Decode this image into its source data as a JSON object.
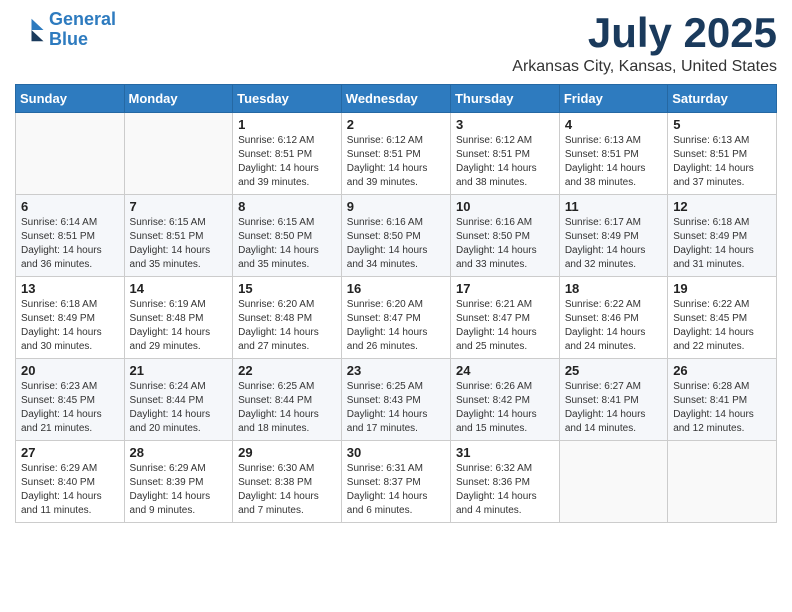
{
  "header": {
    "logo_line1": "General",
    "logo_line2": "Blue",
    "month": "July 2025",
    "location": "Arkansas City, Kansas, United States"
  },
  "days_of_week": [
    "Sunday",
    "Monday",
    "Tuesday",
    "Wednesday",
    "Thursday",
    "Friday",
    "Saturday"
  ],
  "weeks": [
    [
      {
        "day": "",
        "sunrise": "",
        "sunset": "",
        "daylight": ""
      },
      {
        "day": "",
        "sunrise": "",
        "sunset": "",
        "daylight": ""
      },
      {
        "day": "1",
        "sunrise": "Sunrise: 6:12 AM",
        "sunset": "Sunset: 8:51 PM",
        "daylight": "Daylight: 14 hours and 39 minutes."
      },
      {
        "day": "2",
        "sunrise": "Sunrise: 6:12 AM",
        "sunset": "Sunset: 8:51 PM",
        "daylight": "Daylight: 14 hours and 39 minutes."
      },
      {
        "day": "3",
        "sunrise": "Sunrise: 6:12 AM",
        "sunset": "Sunset: 8:51 PM",
        "daylight": "Daylight: 14 hours and 38 minutes."
      },
      {
        "day": "4",
        "sunrise": "Sunrise: 6:13 AM",
        "sunset": "Sunset: 8:51 PM",
        "daylight": "Daylight: 14 hours and 38 minutes."
      },
      {
        "day": "5",
        "sunrise": "Sunrise: 6:13 AM",
        "sunset": "Sunset: 8:51 PM",
        "daylight": "Daylight: 14 hours and 37 minutes."
      }
    ],
    [
      {
        "day": "6",
        "sunrise": "Sunrise: 6:14 AM",
        "sunset": "Sunset: 8:51 PM",
        "daylight": "Daylight: 14 hours and 36 minutes."
      },
      {
        "day": "7",
        "sunrise": "Sunrise: 6:15 AM",
        "sunset": "Sunset: 8:51 PM",
        "daylight": "Daylight: 14 hours and 35 minutes."
      },
      {
        "day": "8",
        "sunrise": "Sunrise: 6:15 AM",
        "sunset": "Sunset: 8:50 PM",
        "daylight": "Daylight: 14 hours and 35 minutes."
      },
      {
        "day": "9",
        "sunrise": "Sunrise: 6:16 AM",
        "sunset": "Sunset: 8:50 PM",
        "daylight": "Daylight: 14 hours and 34 minutes."
      },
      {
        "day": "10",
        "sunrise": "Sunrise: 6:16 AM",
        "sunset": "Sunset: 8:50 PM",
        "daylight": "Daylight: 14 hours and 33 minutes."
      },
      {
        "day": "11",
        "sunrise": "Sunrise: 6:17 AM",
        "sunset": "Sunset: 8:49 PM",
        "daylight": "Daylight: 14 hours and 32 minutes."
      },
      {
        "day": "12",
        "sunrise": "Sunrise: 6:18 AM",
        "sunset": "Sunset: 8:49 PM",
        "daylight": "Daylight: 14 hours and 31 minutes."
      }
    ],
    [
      {
        "day": "13",
        "sunrise": "Sunrise: 6:18 AM",
        "sunset": "Sunset: 8:49 PM",
        "daylight": "Daylight: 14 hours and 30 minutes."
      },
      {
        "day": "14",
        "sunrise": "Sunrise: 6:19 AM",
        "sunset": "Sunset: 8:48 PM",
        "daylight": "Daylight: 14 hours and 29 minutes."
      },
      {
        "day": "15",
        "sunrise": "Sunrise: 6:20 AM",
        "sunset": "Sunset: 8:48 PM",
        "daylight": "Daylight: 14 hours and 27 minutes."
      },
      {
        "day": "16",
        "sunrise": "Sunrise: 6:20 AM",
        "sunset": "Sunset: 8:47 PM",
        "daylight": "Daylight: 14 hours and 26 minutes."
      },
      {
        "day": "17",
        "sunrise": "Sunrise: 6:21 AM",
        "sunset": "Sunset: 8:47 PM",
        "daylight": "Daylight: 14 hours and 25 minutes."
      },
      {
        "day": "18",
        "sunrise": "Sunrise: 6:22 AM",
        "sunset": "Sunset: 8:46 PM",
        "daylight": "Daylight: 14 hours and 24 minutes."
      },
      {
        "day": "19",
        "sunrise": "Sunrise: 6:22 AM",
        "sunset": "Sunset: 8:45 PM",
        "daylight": "Daylight: 14 hours and 22 minutes."
      }
    ],
    [
      {
        "day": "20",
        "sunrise": "Sunrise: 6:23 AM",
        "sunset": "Sunset: 8:45 PM",
        "daylight": "Daylight: 14 hours and 21 minutes."
      },
      {
        "day": "21",
        "sunrise": "Sunrise: 6:24 AM",
        "sunset": "Sunset: 8:44 PM",
        "daylight": "Daylight: 14 hours and 20 minutes."
      },
      {
        "day": "22",
        "sunrise": "Sunrise: 6:25 AM",
        "sunset": "Sunset: 8:44 PM",
        "daylight": "Daylight: 14 hours and 18 minutes."
      },
      {
        "day": "23",
        "sunrise": "Sunrise: 6:25 AM",
        "sunset": "Sunset: 8:43 PM",
        "daylight": "Daylight: 14 hours and 17 minutes."
      },
      {
        "day": "24",
        "sunrise": "Sunrise: 6:26 AM",
        "sunset": "Sunset: 8:42 PM",
        "daylight": "Daylight: 14 hours and 15 minutes."
      },
      {
        "day": "25",
        "sunrise": "Sunrise: 6:27 AM",
        "sunset": "Sunset: 8:41 PM",
        "daylight": "Daylight: 14 hours and 14 minutes."
      },
      {
        "day": "26",
        "sunrise": "Sunrise: 6:28 AM",
        "sunset": "Sunset: 8:41 PM",
        "daylight": "Daylight: 14 hours and 12 minutes."
      }
    ],
    [
      {
        "day": "27",
        "sunrise": "Sunrise: 6:29 AM",
        "sunset": "Sunset: 8:40 PM",
        "daylight": "Daylight: 14 hours and 11 minutes."
      },
      {
        "day": "28",
        "sunrise": "Sunrise: 6:29 AM",
        "sunset": "Sunset: 8:39 PM",
        "daylight": "Daylight: 14 hours and 9 minutes."
      },
      {
        "day": "29",
        "sunrise": "Sunrise: 6:30 AM",
        "sunset": "Sunset: 8:38 PM",
        "daylight": "Daylight: 14 hours and 7 minutes."
      },
      {
        "day": "30",
        "sunrise": "Sunrise: 6:31 AM",
        "sunset": "Sunset: 8:37 PM",
        "daylight": "Daylight: 14 hours and 6 minutes."
      },
      {
        "day": "31",
        "sunrise": "Sunrise: 6:32 AM",
        "sunset": "Sunset: 8:36 PM",
        "daylight": "Daylight: 14 hours and 4 minutes."
      },
      {
        "day": "",
        "sunrise": "",
        "sunset": "",
        "daylight": ""
      },
      {
        "day": "",
        "sunrise": "",
        "sunset": "",
        "daylight": ""
      }
    ]
  ]
}
